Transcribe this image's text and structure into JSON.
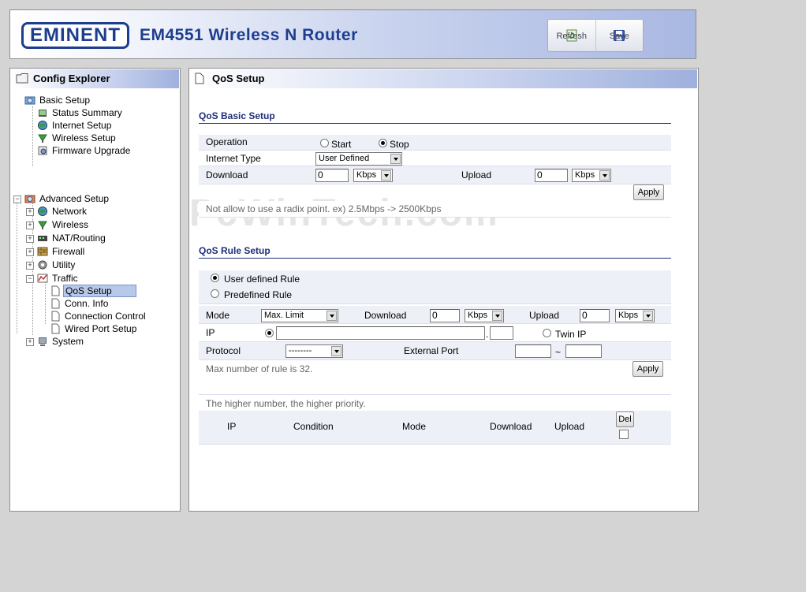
{
  "header": {
    "logo": "EMINENT",
    "product_title": "EM4551 Wireless N Router",
    "toolbar": {
      "refresh_label": "Refresh",
      "save_label": "Save"
    }
  },
  "sidebar": {
    "title": "Config Explorer",
    "tree": {
      "basic": {
        "label": "Basic Setup",
        "children": [
          "Status Summary",
          "Internet Setup",
          "Wireless Setup",
          "Firmware Upgrade"
        ]
      },
      "advanced": {
        "label": "Advanced Setup",
        "children": [
          "Network",
          "Wireless",
          "NAT/Routing",
          "Firewall",
          "Utility",
          "Traffic",
          "System"
        ]
      },
      "traffic_children": [
        "QoS Setup",
        "Conn. Info",
        "Connection Control",
        "Wired Port Setup"
      ],
      "selected": "QoS Setup"
    }
  },
  "content": {
    "title": "QoS Setup",
    "watermark": "PcWinTech.com",
    "basic": {
      "section_title": "QoS Basic Setup",
      "operation_label": "Operation",
      "start_label": "Start",
      "stop_label": "Stop",
      "operation_selected": "Stop",
      "internet_type_label": "Internet Type",
      "internet_type_value": "User Defined",
      "download_label": "Download",
      "download_value": "0",
      "download_unit": "Kbps",
      "upload_label": "Upload",
      "upload_value": "0",
      "upload_unit": "Kbps",
      "apply_label": "Apply",
      "note": "Not allow to use a radix point. ex) 2.5Mbps -> 2500Kbps"
    },
    "rule": {
      "section_title": "QoS Rule Setup",
      "user_defined_label": "User defined Rule",
      "predefined_label": "Predefined Rule",
      "rule_selected": "User defined Rule",
      "mode_label": "Mode",
      "mode_value": "Max. Limit",
      "download_label": "Download",
      "download_value": "0",
      "download_unit": "Kbps",
      "upload_label": "Upload",
      "upload_value": "0",
      "upload_unit": "Kbps",
      "ip_label": "IP",
      "twin_ip_label": "Twin IP",
      "ip_separator": ".",
      "protocol_label": "Protocol",
      "protocol_value": "--------",
      "external_port_label": "External Port",
      "port_separator": "~",
      "max_rule_note": "Max number of rule is 32.",
      "apply_label": "Apply"
    },
    "list": {
      "priority_note": "The higher number, the higher priority.",
      "columns": [
        "IP",
        "Condition",
        "Mode",
        "Download",
        "Upload"
      ],
      "del_label": "Del"
    }
  }
}
